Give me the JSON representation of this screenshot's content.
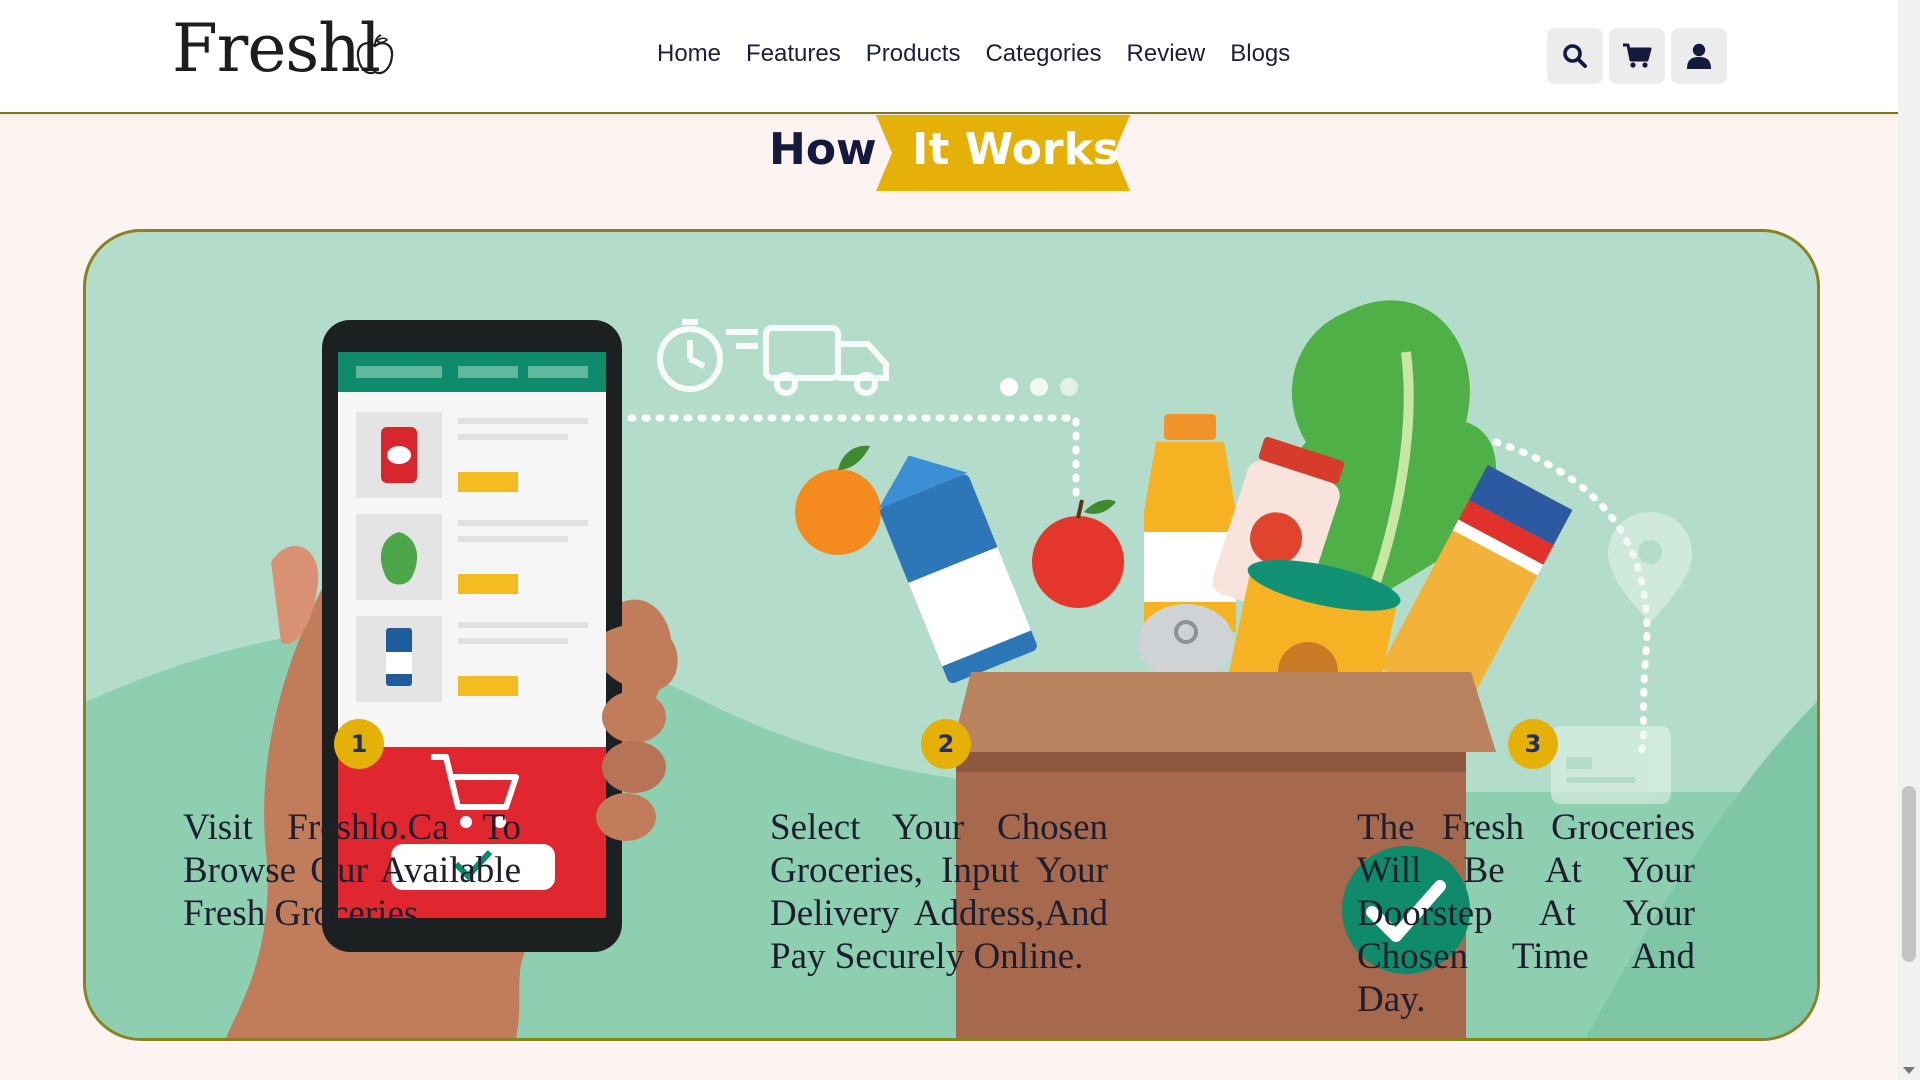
{
  "brand": {
    "logo_text": "Freshl"
  },
  "nav": {
    "items": [
      "Home",
      "Features",
      "Products",
      "Categories",
      "Review",
      "Blogs"
    ]
  },
  "header_icons": [
    "search-icon",
    "cart-icon",
    "user-icon"
  ],
  "section": {
    "heading_plain": "How",
    "heading_highlight": "It Works"
  },
  "steps": [
    {
      "number": "1",
      "text": "Visit Freshlo.Ca To Browse Our Available Fresh Groceries"
    },
    {
      "number": "2",
      "text": "Select Your Chosen Groceries, Input Your Delivery Address,And Pay Securely Online."
    },
    {
      "number": "3",
      "text": "The Fresh Groceries Will Be At Your Doorstep At Your Chosen Time And Day."
    }
  ],
  "colors": {
    "accent": "#e5b008",
    "navy": "#141a3e",
    "card_bg": "#b3ddca",
    "page_bg": "#fdf3f1",
    "border_olive": "#8a8120"
  }
}
